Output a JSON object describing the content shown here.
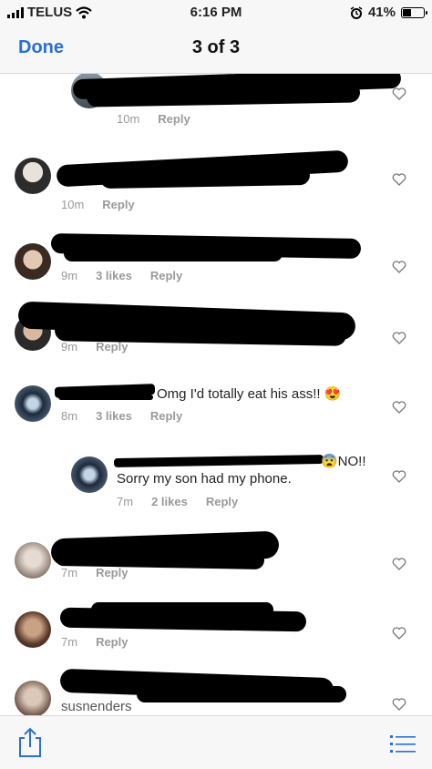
{
  "status_bar": {
    "carrier": "TELUS",
    "time": "6:16 PM",
    "battery": "41%",
    "battery_level": 0.41,
    "icons": [
      "signal-bars-icon",
      "wifi-icon",
      "alarm-icon",
      "battery-icon"
    ]
  },
  "nav": {
    "done_label": "Done",
    "title": "3 of 3"
  },
  "comments": [
    {
      "time": "10m",
      "likes": "",
      "reply": "Reply",
      "text": ""
    },
    {
      "time": "10m",
      "likes": "",
      "reply": "Reply",
      "text": ""
    },
    {
      "time": "9m",
      "likes": "3 likes",
      "reply": "Reply",
      "text": ""
    },
    {
      "time": "9m",
      "likes": "",
      "reply": "Reply",
      "text": ""
    },
    {
      "time": "8m",
      "likes": "3 likes",
      "reply": "Reply",
      "text": "Omg I'd totally eat his ass!! 😍"
    },
    {
      "time": "7m",
      "likes": "2 likes",
      "reply": "Reply",
      "text": "😨NO!!",
      "text2": "Sorry my son had my phone."
    },
    {
      "time": "7m",
      "likes": "",
      "reply": "Reply",
      "text": ""
    },
    {
      "time": "7m",
      "likes": "",
      "reply": "Reply",
      "text": ""
    },
    {
      "time": "",
      "likes": "",
      "reply": "",
      "text": "",
      "partial": "susnenders"
    }
  ],
  "toolbar": {
    "icons": [
      "share-icon",
      "list-icon"
    ]
  },
  "colors": {
    "accent": "#2a6fd6",
    "meta_text": "#9a9a9a",
    "bar_bg": "#f7f7f7"
  }
}
